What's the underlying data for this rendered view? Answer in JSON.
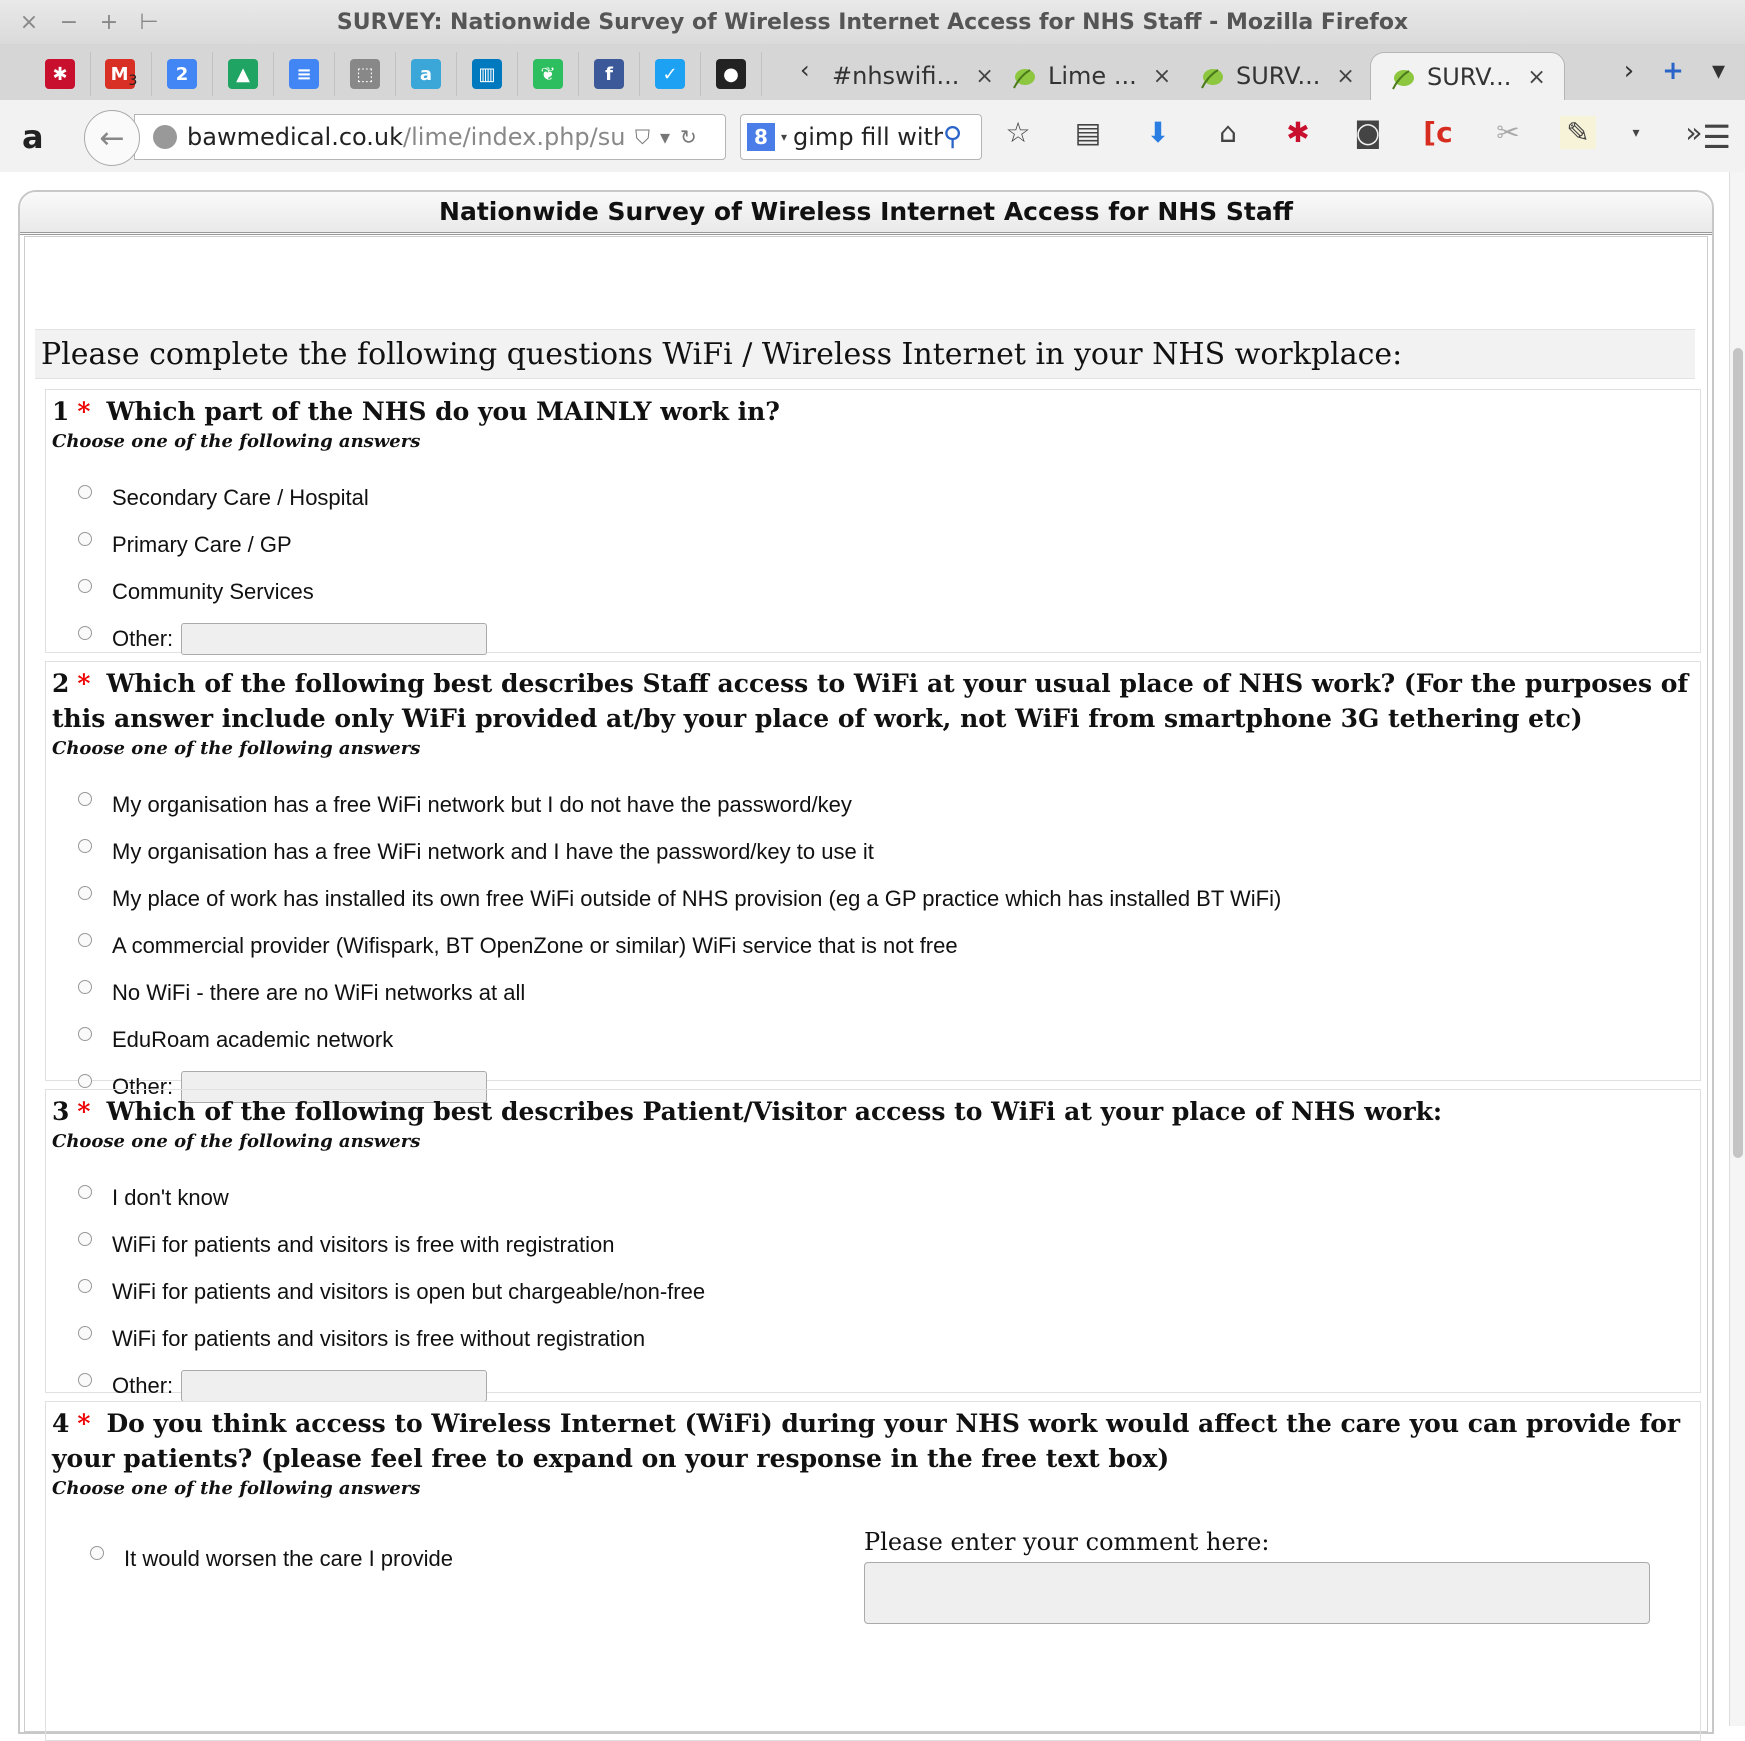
{
  "window": {
    "title": "SURVEY: Nationwide Survey of Wireless Internet Access for NHS Staff - Mozilla Firefox",
    "controls": [
      "×",
      "−",
      "+",
      "⊢"
    ]
  },
  "tabs": {
    "pinned": [
      {
        "name": "lastpass",
        "glyph": "✱",
        "color": "#c8102e"
      },
      {
        "name": "gmail",
        "glyph": "M",
        "badge": "3",
        "color": "#d93025"
      },
      {
        "name": "calendar",
        "glyph": "2",
        "color": "#4285f4"
      },
      {
        "name": "drive",
        "glyph": "▲",
        "color": "#1fa463"
      },
      {
        "name": "docs",
        "glyph": "≡",
        "color": "#4285f4"
      },
      {
        "name": "screenshot",
        "glyph": "⬚",
        "color": "#888888"
      },
      {
        "name": "amazon-a",
        "glyph": "a",
        "color": "#3aa7d8"
      },
      {
        "name": "trello",
        "glyph": "▥",
        "color": "#0079bf"
      },
      {
        "name": "evernote",
        "glyph": "❦",
        "color": "#2dbe60"
      },
      {
        "name": "facebook",
        "glyph": "f",
        "color": "#3b5998"
      },
      {
        "name": "twitter",
        "glyph": "✓",
        "color": "#1da1f2"
      },
      {
        "name": "github",
        "glyph": "●",
        "color": "#222222"
      }
    ],
    "open": [
      {
        "label": "#nhswifi...",
        "active": false
      },
      {
        "label": "Lime ...",
        "active": false
      },
      {
        "label": "SURV...",
        "active": false
      },
      {
        "label": "SURV...",
        "active": true
      }
    ],
    "close_glyph": "×",
    "scroll_left": "‹",
    "scroll_right": "›",
    "new_tab": "+",
    "list_all": "▾"
  },
  "navbar": {
    "amazon_glyph": "a",
    "url_host": "bawmedical.co.uk",
    "url_path": "/lime/index.php/survey",
    "search_value": "gimp fill with",
    "search_engine_glyph": "8"
  },
  "survey": {
    "header": "Nationwide Survey of Wireless Internet Access for NHS Staff",
    "intro": "Please complete the following questions WiFi / Wireless Internet in your NHS workplace:",
    "help_text": "Choose one of the following answers",
    "required_mark": "*",
    "other_label": "Other:",
    "q1": {
      "num": "1",
      "title": "Which part of the NHS do you MAINLY work in?",
      "options": [
        "Secondary Care / Hospital",
        "Primary Care / GP",
        "Community Services"
      ]
    },
    "q2": {
      "num": "2",
      "title": "Which of the following best describes Staff access to WiFi at your usual place of NHS work? (For the purposes of this answer include only WiFi provided at/by your place of work, not WiFi from smartphone 3G tethering etc)",
      "options": [
        "My organisation has a free WiFi network but I do not have the password/key",
        "My organisation has a free WiFi network and I have the password/key to use it",
        "My place of work has installed its own free WiFi outside of NHS provision (eg a GP practice which has installed BT WiFi)",
        "A commercial provider (Wifispark, BT OpenZone or similar) WiFi service that is not free",
        "No WiFi - there are no WiFi networks at all",
        "EduRoam academic network"
      ]
    },
    "q3": {
      "num": "3",
      "title": "Which of the following best describes Patient/Visitor access to WiFi at your place of NHS work:",
      "options": [
        "I don't know",
        "WiFi for patients and visitors is free with registration",
        "WiFi for patients and visitors is open but chargeable/non-free",
        "WiFi for patients and visitors is free without registration"
      ]
    },
    "q4": {
      "num": "4",
      "title": "Do you think access to Wireless Internet (WiFi) during your NHS work would affect the care you can provide for your patients? (please feel free to expand on your response in the free text box)",
      "options": [
        "It would worsen the care I provide"
      ],
      "comment_label": "Please enter your comment here:"
    }
  }
}
